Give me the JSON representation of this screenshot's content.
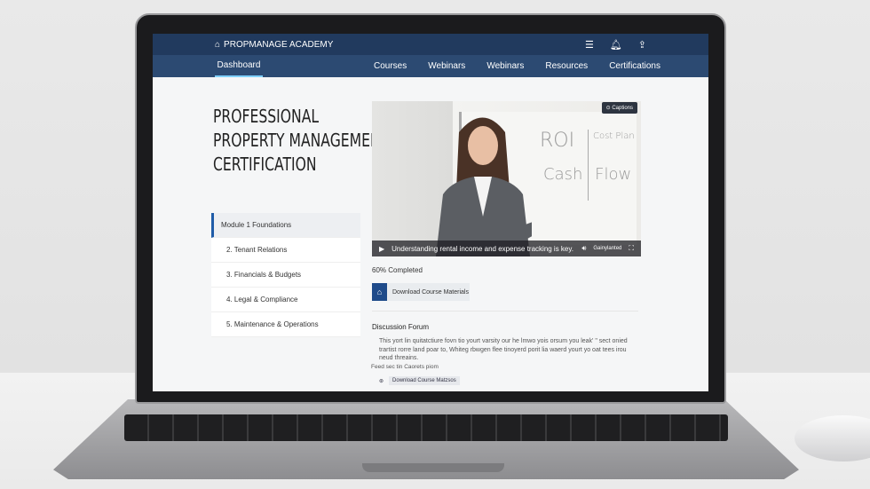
{
  "header": {
    "brand": "PROPMANAGE ACADEMY",
    "icons": [
      "menu-icon",
      "notification-icon",
      "profile-icon"
    ]
  },
  "nav": {
    "active": "Dashboard",
    "items": [
      "Courses",
      "Webinars",
      "Webinars",
      "Resources",
      "Certifications"
    ]
  },
  "course": {
    "title_lines": [
      "PROFESSIONAL",
      "PROPERTY MANAGEMENT",
      "CERTIFICATION"
    ]
  },
  "modules": [
    "Module 1 Foundations",
    "2.  Tenant Relations",
    "3.  Financials & Budgets",
    "4.  Legal & Compliance",
    "5.  Maintenance & Operations"
  ],
  "video": {
    "badge": "⊙ Captions",
    "caption": "Understanding rental income and expense tracking is key.",
    "control_label": "Gainylanted",
    "whiteboard": [
      "ROI",
      "Cash Flow",
      "Cost Plan"
    ]
  },
  "progress": {
    "label": "60% Completed",
    "value": 60
  },
  "download": {
    "label": "Download Course Materials"
  },
  "forum": {
    "title": "Discussion Forum",
    "text": "This yort lin quitatctiure fovn tio yourt varsity our he lmwo yois orsum you leak' \" sect onied trartist rorre land poar to, Whiteg rbwgen flee tinoyerd porit lia waerd yourt yo oat tees irou neud threains.",
    "feed_label": "Feed sec tin Caorets piom",
    "item": "Download Course Matzsos"
  },
  "colors": {
    "header": "#213a5e",
    "nav": "#2c4a72",
    "accent": "#1f5ca8"
  }
}
